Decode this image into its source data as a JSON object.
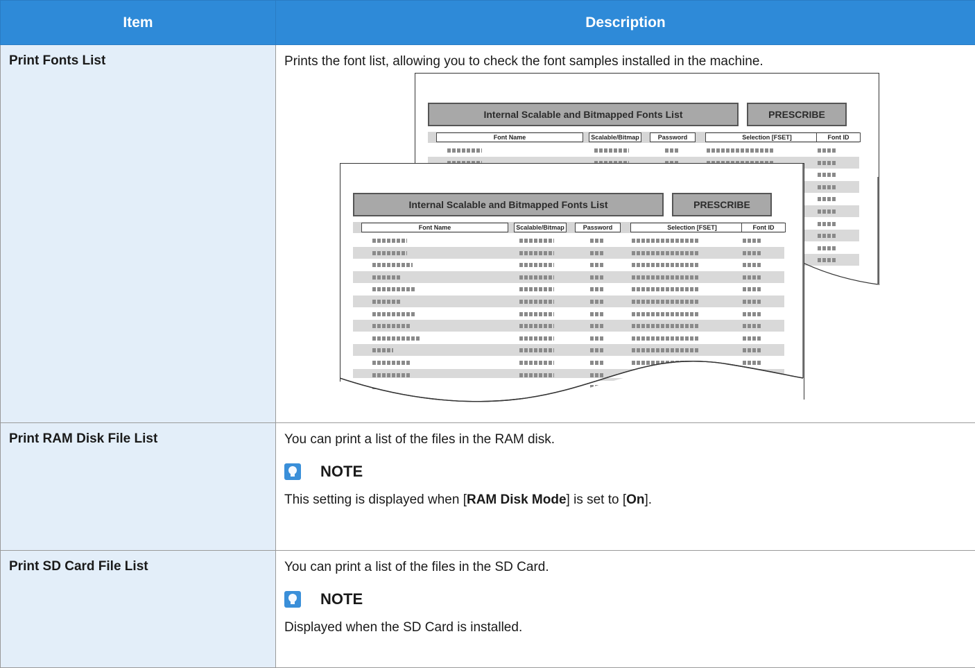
{
  "table": {
    "headers": {
      "item": "Item",
      "description": "Description"
    },
    "rows": [
      {
        "item": "Print Fonts List",
        "text": "Prints the font list, allowing you to check the font samples installed in the machine."
      },
      {
        "item": "Print RAM Disk File List",
        "text": "You can print a list of the files in the RAM disk.",
        "note_title": "NOTE",
        "note_pre": "This setting is displayed when [",
        "note_bold1": "RAM Disk Mode",
        "note_mid": "] is set to [",
        "note_bold2": "On",
        "note_post": "]."
      },
      {
        "item": "Print SD Card File List",
        "text": "You can print a list of the files in the SD Card.",
        "note_title": "NOTE",
        "note_text": "Displayed when the SD Card is installed."
      }
    ]
  },
  "illustration": {
    "banner_title": "Internal Scalable and Bitmapped Fonts List",
    "banner_brand": "PRESCRIBE",
    "columns": [
      "Font Name",
      "Scalable/Bitmap",
      "Password",
      "Selection       [FSET]",
      "Font ID"
    ]
  }
}
